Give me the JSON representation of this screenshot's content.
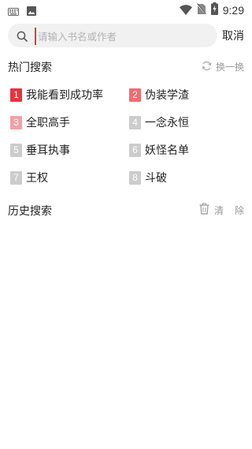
{
  "status_bar": {
    "time": "9:29",
    "icons": [
      "keyboard-icon",
      "image-icon",
      "wifi-icon",
      "no-sim-icon",
      "battery-charging-icon"
    ]
  },
  "search": {
    "placeholder": "请输入书名或作者",
    "value": "",
    "cancel_label": "取消",
    "icon": "search-icon"
  },
  "hot_search": {
    "title": "热门搜索",
    "refresh_label": "换一换",
    "items": [
      {
        "rank": "1",
        "title": "我能看到成功率",
        "color": "#e8333c"
      },
      {
        "rank": "2",
        "title": "伪装学渣",
        "color": "#f06c72"
      },
      {
        "rank": "3",
        "title": "全职高手",
        "color": "#f1a1a6"
      },
      {
        "rank": "4",
        "title": "一念永恒",
        "color": "#cccccc"
      },
      {
        "rank": "5",
        "title": "垂耳执事",
        "color": "#cccccc"
      },
      {
        "rank": "6",
        "title": "妖怪名单",
        "color": "#cccccc"
      },
      {
        "rank": "7",
        "title": "王权",
        "color": "#cccccc"
      },
      {
        "rank": "8",
        "title": "斗破",
        "color": "#cccccc"
      }
    ]
  },
  "history": {
    "title": "历史搜索",
    "clear_label": "清除",
    "clear_icon": "trash-icon"
  },
  "colors": {
    "accent": "#e53935",
    "search_bg": "#f1f1f1",
    "muted_text": "#999999"
  }
}
